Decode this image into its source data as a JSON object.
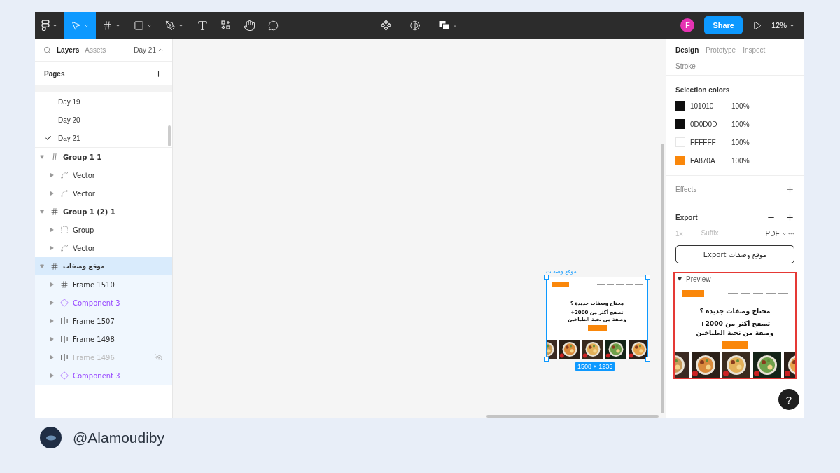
{
  "toolbar": {
    "tools": [
      {
        "kind": "main-menu",
        "selected": false,
        "dropdown": true
      },
      {
        "kind": "move",
        "selected": true,
        "dropdown": true
      },
      {
        "kind": "frame",
        "selected": false,
        "dropdown": true
      },
      {
        "kind": "shape",
        "selected": false,
        "dropdown": true
      },
      {
        "kind": "pen",
        "selected": false,
        "dropdown": true
      },
      {
        "kind": "text",
        "selected": false,
        "dropdown": false
      },
      {
        "kind": "resources",
        "selected": false,
        "dropdown": false
      },
      {
        "kind": "hand",
        "selected": false,
        "dropdown": false
      },
      {
        "kind": "comment",
        "selected": false,
        "dropdown": false
      }
    ],
    "center_tools": [
      {
        "kind": "component",
        "dropdown": false
      },
      {
        "kind": "mask",
        "dropdown": false
      },
      {
        "kind": "boolean",
        "dropdown": true
      }
    ],
    "user_avatar": "F",
    "share": "Share",
    "zoom": "12%"
  },
  "left_panel": {
    "tabs": [
      {
        "label": "Layers",
        "selected": true
      },
      {
        "label": "Assets",
        "selected": false
      }
    ],
    "page_switcher": "Day 21",
    "pages_title": "Pages",
    "pages": [
      {
        "name": "Day 19",
        "selected": false
      },
      {
        "name": "Day 20",
        "selected": false
      },
      {
        "name": "Day 21",
        "selected": true
      }
    ],
    "layers": [
      {
        "name": "Group 1 1",
        "kind": "frame",
        "expanded": true,
        "selected": false,
        "hidden": false,
        "children": [
          {
            "name": "Vector",
            "kind": "vector",
            "expanded": false,
            "selected": false,
            "hidden": false
          },
          {
            "name": "Vector",
            "kind": "vector",
            "expanded": false,
            "selected": false,
            "hidden": false
          }
        ]
      },
      {
        "name": "Group 1 (2) 1",
        "kind": "frame",
        "expanded": true,
        "selected": false,
        "hidden": false,
        "children": [
          {
            "name": "Group",
            "kind": "group",
            "expanded": false,
            "selected": false,
            "hidden": false
          },
          {
            "name": "Vector",
            "kind": "vector",
            "expanded": false,
            "selected": false,
            "hidden": false
          }
        ]
      },
      {
        "name": "موقع وصفات",
        "kind": "frame",
        "expanded": true,
        "selected": true,
        "hidden": false,
        "children": [
          {
            "name": "Frame 1510",
            "kind": "frame",
            "expanded": false,
            "selected": false,
            "hidden": false
          },
          {
            "name": "Component 3",
            "kind": "component",
            "expanded": false,
            "selected": false,
            "hidden": false
          },
          {
            "name": "Frame 1507",
            "kind": "autolayout",
            "expanded": false,
            "selected": false,
            "hidden": false
          },
          {
            "name": "Frame 1498",
            "kind": "autolayout",
            "expanded": false,
            "selected": false,
            "hidden": false
          },
          {
            "name": "Frame 1496",
            "kind": "autolayout",
            "expanded": false,
            "selected": false,
            "hidden": true
          },
          {
            "name": "Component 3",
            "kind": "component",
            "expanded": false,
            "selected": false,
            "hidden": false
          }
        ]
      }
    ]
  },
  "canvas": {
    "frame": {
      "label": "موقع وصفات",
      "headline": "محتاج وصفات جديدة ؟",
      "subline": "تصفح أكثر من 2000+ وصفة من نخبة الطباخين",
      "size": "1508 × 1235"
    }
  },
  "right_panel": {
    "tabs": [
      {
        "label": "Design",
        "selected": true
      },
      {
        "label": "Prototype",
        "selected": false
      },
      {
        "label": "Inspect",
        "selected": false
      }
    ],
    "stroke_title": "Stroke",
    "selection_colors_title": "Selection colors",
    "selection_colors": [
      {
        "color": "#101010",
        "hex": "101010",
        "opacity": "100%"
      },
      {
        "color": "#0d0d0d",
        "hex": "0D0D0D",
        "opacity": "100%"
      },
      {
        "color": "#ffffff",
        "hex": "FFFFFF",
        "opacity": "100%"
      },
      {
        "color": "#fa870a",
        "hex": "FA870A",
        "opacity": "100%"
      }
    ],
    "effects_title": "Effects",
    "export": {
      "title": "Export",
      "scale": "1x",
      "suffix_placeholder": "Suffix",
      "format": "PDF",
      "button": "Export موقع وصفات"
    },
    "preview": {
      "title": "Preview",
      "expanded": true,
      "headline": "محتاج وصفات جديدة ؟",
      "subline": "تصفح أكثر من 2000+ وصفة من نخبة الطباخين"
    },
    "help": "?"
  },
  "footer": {
    "handle": "@Alamoudiby"
  }
}
